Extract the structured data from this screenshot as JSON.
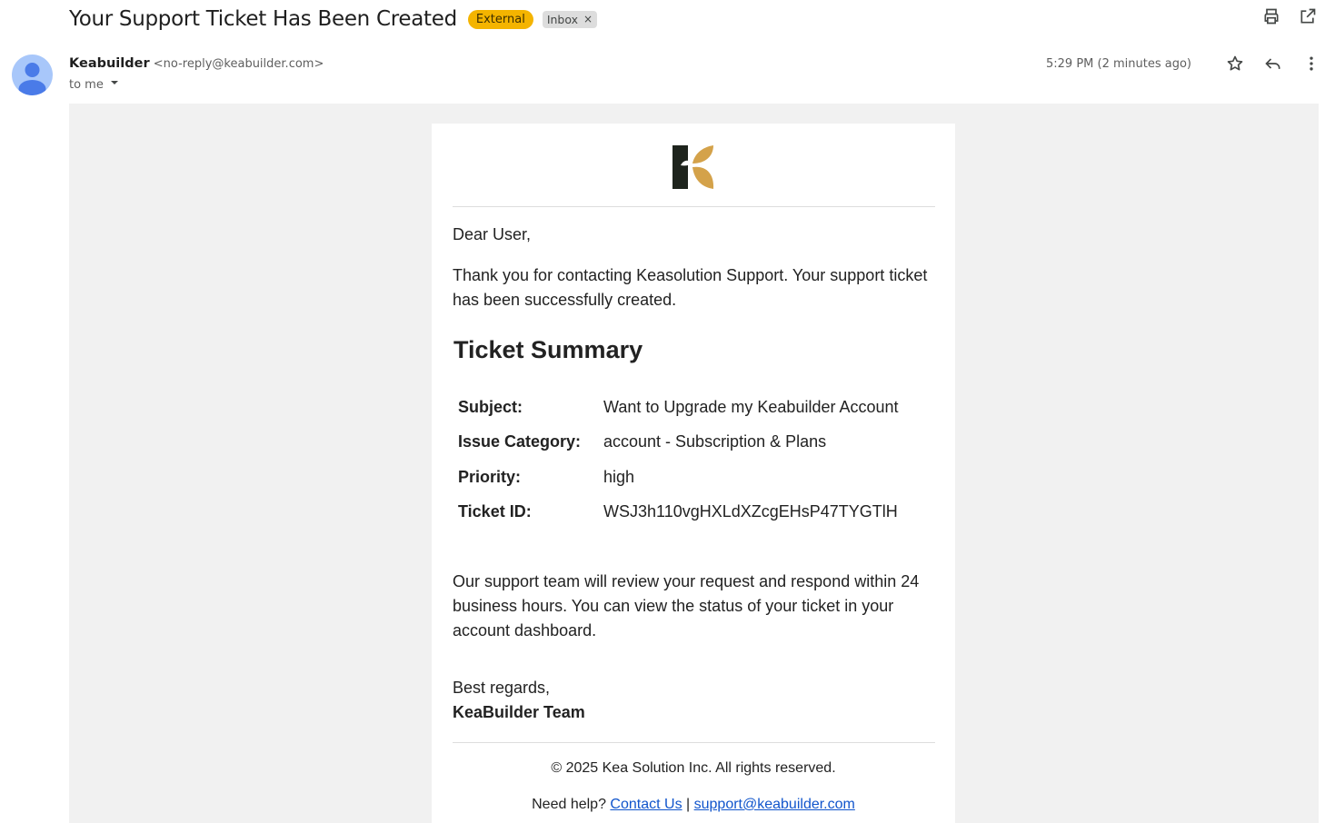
{
  "subject": "Your Support Ticket Has Been Created",
  "labels": {
    "external": "External",
    "inbox": "Inbox",
    "remove": "×"
  },
  "sender": {
    "name": "Keabuilder",
    "email": "<no-reply@keabuilder.com>",
    "to": "to me"
  },
  "timestamp": "5:29 PM (2 minutes ago)",
  "icons": [
    "print-icon",
    "open-in-new-window-icon",
    "star-icon",
    "reply-icon",
    "more-vert-icon",
    "avatar-icon",
    "logo"
  ],
  "colors": {
    "external_badge": "#f4b400",
    "link": "#1155cc",
    "email_bg": "#f1f1f1",
    "logo_dark": "#1e241d",
    "logo_gold": "#d4a24a"
  },
  "body": {
    "greeting": "Dear User,",
    "intro": "Thank you for contacting Keasolution Support. Your support ticket has been successfully created.",
    "summary_heading": "Ticket Summary",
    "summary": [
      {
        "label": "Subject:",
        "value": "Want to Upgrade my Keabuilder Account"
      },
      {
        "label": "Issue Category:",
        "value": "account - Subscription & Plans"
      },
      {
        "label": "Priority:",
        "value": "high"
      },
      {
        "label": "Ticket ID:",
        "value": "WSJ3h110vgHXLdXZcgEHsP47TYGTlH"
      }
    ],
    "followup": "Our support team will review your request and respond within 24 business hours. You can view the status of your ticket in your account dashboard.",
    "regards": "Best regards,",
    "team": "KeaBuilder Team",
    "copyright": "© 2025 Kea Solution Inc. All rights reserved.",
    "help_prefix": "Need help?",
    "contact_link": "Contact Us",
    "separator": "|",
    "support_email": "support@keabuilder.com"
  }
}
